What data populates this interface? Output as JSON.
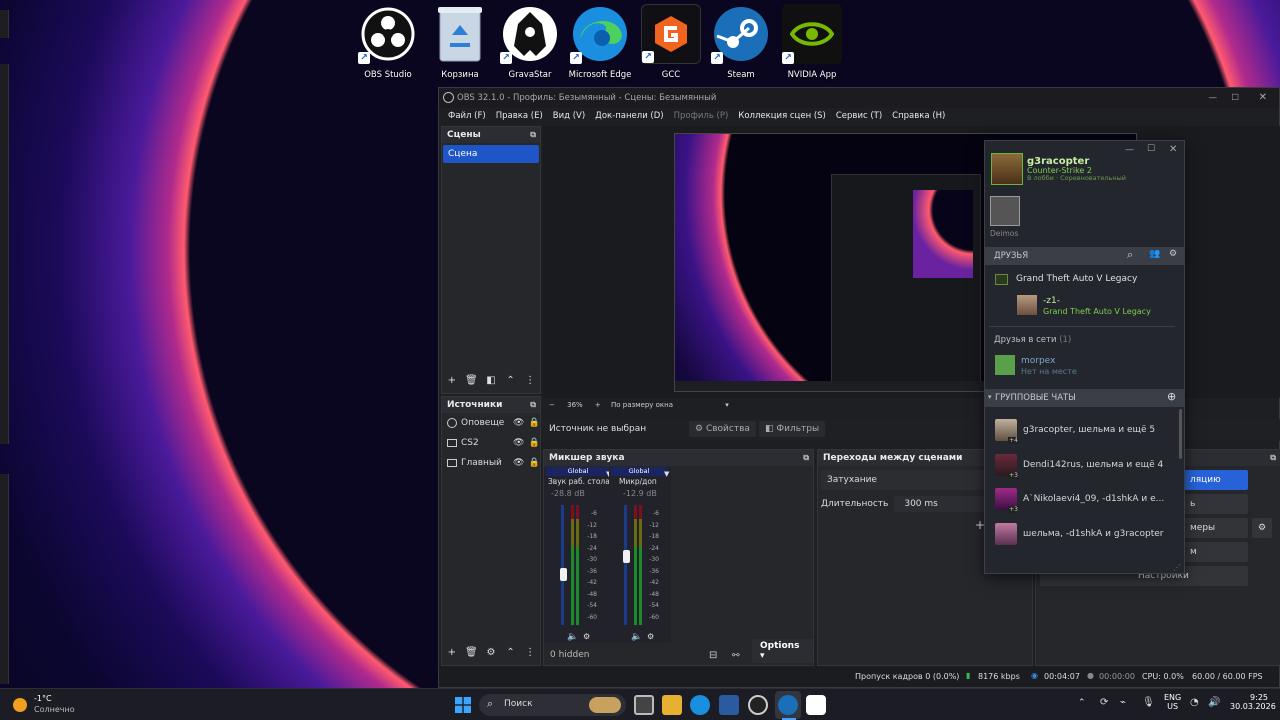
{
  "desktop_icons": [
    {
      "label": "OBS Studio",
      "icon": "obs-icon"
    },
    {
      "label": "Корзина",
      "icon": "recycle-bin-icon"
    },
    {
      "label": "GravaStar",
      "icon": "gravastar-icon"
    },
    {
      "label": "Microsoft Edge",
      "icon": "edge-icon"
    },
    {
      "label": "GCC",
      "icon": "gcc-icon"
    },
    {
      "label": "Steam",
      "icon": "steam-icon"
    },
    {
      "label": "NVIDIA App",
      "icon": "nvidia-icon"
    }
  ],
  "obs": {
    "title": "OBS 32.1.0 - Профиль: Безымянный - Сцены: Безымянный",
    "menu": [
      "Файл (F)",
      "Правка (E)",
      "Вид (V)",
      "Док-панели (D)",
      "Профиль (P)",
      "Коллекция сцен (S)",
      "Сервис (T)",
      "Справка (H)"
    ],
    "scenes": {
      "title": "Сцены",
      "items": [
        "Сцена"
      ]
    },
    "sources": {
      "title": "Источники",
      "items": [
        "Оповеще",
        "CS2",
        "Главный"
      ]
    },
    "preview": {
      "zoom": "36%",
      "fit": "По размеру окна"
    },
    "source_bar": {
      "status": "Источник не выбран",
      "props": "Свойства",
      "filters": "Фильтры"
    },
    "mixer": {
      "title": "Микшер звука",
      "hidden": "0 hidden",
      "options": "Options",
      "channels": [
        {
          "global": "Global",
          "name": "Звук раб. стола",
          "db": "-28.8 dB"
        },
        {
          "global": "Global",
          "name": "Микр/доп",
          "db": "-12.9 dB"
        }
      ],
      "ticks": [
        "-6",
        "-12",
        "-18",
        "-24",
        "-30",
        "-36",
        "-42",
        "-48",
        "-54",
        "-60"
      ]
    },
    "transitions": {
      "title": "Переходы между сценами",
      "type": "Затухание",
      "duration_label": "Длительность",
      "duration": "300 ms"
    },
    "controls": {
      "start": "ляцию",
      "b2": "ь",
      "b3": "меры",
      "b4": "м",
      "settings": "Настройки"
    },
    "status": {
      "dropped": "Пропуск кадров 0 (0.0%)",
      "bitrate": "8176 kbps",
      "rec": "00:04:07",
      "stream": "00:00:00",
      "cpu": "CPU: 0.0%",
      "fps": "60.00 / 60.00 FPS"
    }
  },
  "steam": {
    "user": {
      "name": "g3racopter",
      "game": "Counter-Strike 2",
      "sub": "В лобби · Соревновательный"
    },
    "deimos": "Deimos",
    "friends_label": "ДРУЗЬЯ",
    "game_group": "Grand Theft Auto V Legacy",
    "friend_in_game": {
      "name": "-z1-",
      "game": "Grand Theft Auto V Legacy"
    },
    "online_label": "Друзья в сети",
    "online_count": "(1)",
    "online_friend": {
      "name": "morpex",
      "status": "Нет на месте"
    },
    "group_label": "ГРУППОВЫЕ ЧАТЫ",
    "groups": [
      {
        "name": "g3racopter, шельма и ещё 5",
        "count": "+4"
      },
      {
        "name": "Dendi142rus, шельма и ещё 4",
        "count": "+3"
      },
      {
        "name": "A`Nikolaevi4_09, -d1shkA и е...",
        "count": "+3"
      },
      {
        "name": "шельма, -d1shkA и g3racopter",
        "count": ""
      }
    ]
  },
  "taskbar": {
    "weather": {
      "temp": "-1°C",
      "desc": "Солнечно"
    },
    "search": "Поиск",
    "lang": "ENG",
    "layout": "US",
    "time": "9:25",
    "date": "30.03.2026"
  }
}
